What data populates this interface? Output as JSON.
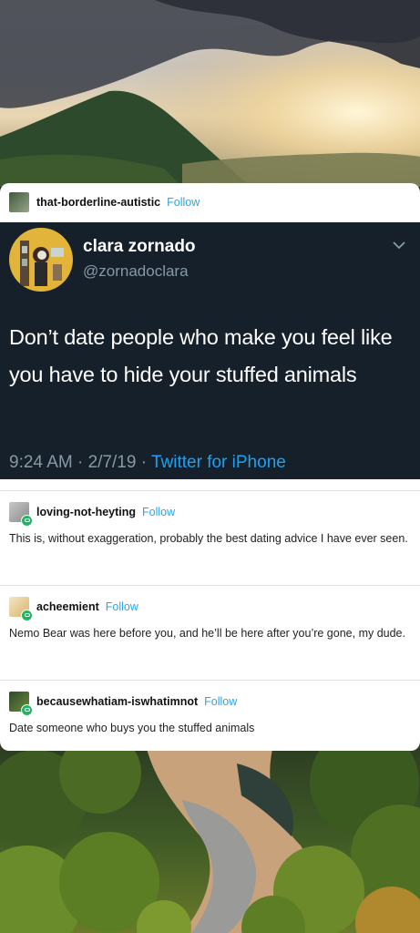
{
  "original_post": {
    "username": "that-borderline-autistic",
    "follow_label": "Follow",
    "tweet": {
      "display_name": "clara zornado",
      "handle": "@zornadoclara",
      "text": "Don’t date people who make you feel like you have to hide your stuffed animals",
      "time": "9:24 AM",
      "separator1": " · ",
      "date": "2/7/19",
      "separator2": " · ",
      "source": "Twitter for iPhone"
    }
  },
  "replies": [
    {
      "username": "loving-not-heyting",
      "follow_label": "Follow",
      "text": "This is, without exaggeration, probably the best dating advice I have ever seen."
    },
    {
      "username": "acheemient",
      "follow_label": "Follow",
      "text": "Nemo Bear was here before you, and he’ll be here after you’re gone, my dude."
    },
    {
      "username": "becausewhatiam-iswhatimnot",
      "follow_label": "Follow",
      "text": "Date someone who buys you the stuffed animals"
    }
  ],
  "colors": {
    "tweet_bg": "#15202b",
    "follow_link": "#2aa4e8",
    "twitter_blue": "#1da1f2",
    "reblog_badge": "#1eb562"
  }
}
